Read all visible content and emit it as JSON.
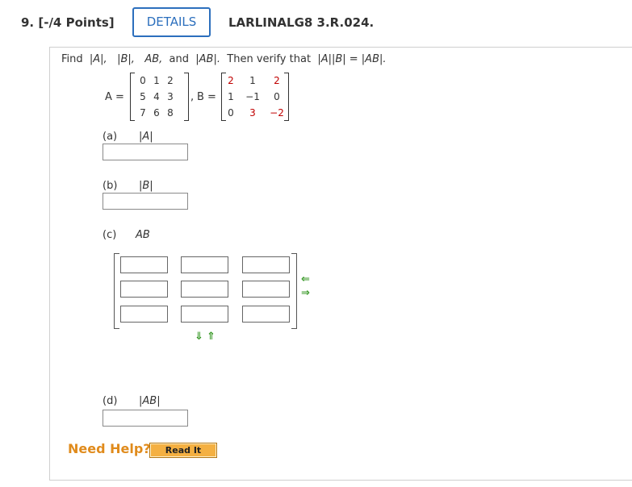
{
  "question": {
    "number_points": "9. [-/4 Points]",
    "details_label": "DETAILS",
    "code": "LARLINALG8 3.R.024."
  },
  "prompt": {
    "find": "Find",
    "absA": "|A|,",
    "absB": "|B|,",
    "AB": "AB,",
    "and": "and",
    "absAB": "|AB|.",
    "then": "Then verify that",
    "eq": "|A||B| = |AB|."
  },
  "matrixA": {
    "label": "A =",
    "rows": [
      [
        "0",
        "1",
        "2"
      ],
      [
        "5",
        "4",
        "3"
      ],
      [
        "7",
        "6",
        "8"
      ]
    ]
  },
  "matrixB": {
    "label": "B =",
    "rows": [
      [
        "2",
        "1",
        "2"
      ],
      [
        "1",
        "−1",
        "0"
      ],
      [
        "0",
        "3",
        "−2"
      ]
    ]
  },
  "comma": ",",
  "parts": {
    "a": {
      "letter": "(a)",
      "label": "|A|",
      "value": ""
    },
    "b": {
      "letter": "(b)",
      "label": "|B|",
      "value": ""
    },
    "c": {
      "letter": "(c)",
      "label": "AB",
      "cells": [
        "",
        "",
        "",
        "",
        "",
        "",
        "",
        "",
        ""
      ]
    },
    "d": {
      "letter": "(d)",
      "label": "|AB|",
      "value": ""
    }
  },
  "icons": [
    "arrow-left-icon",
    "arrow-right-icon",
    "arrow-down-icon",
    "arrow-up-icon"
  ],
  "colors": {
    "accent": "#2c6fbd",
    "red": "#c00000",
    "help": "#e08b1c",
    "arrow": "#3b9a2a",
    "readit": "#f4b042"
  },
  "help": {
    "label": "Need Help?",
    "read_it": "Read It"
  }
}
